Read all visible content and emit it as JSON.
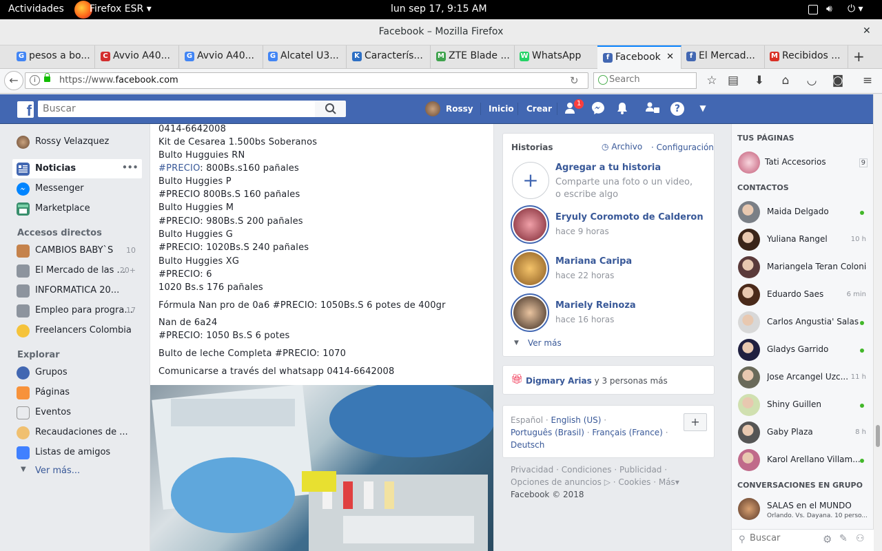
{
  "gnome": {
    "activities": "Actividades",
    "app": "Firefox ESR ▾",
    "clock": "lun sep 17,  9:15 AM"
  },
  "window": {
    "title": "Facebook – Mozilla Firefox"
  },
  "tabs": [
    {
      "label": "pesos a bo...",
      "color": "#4285f4",
      "letter": "G"
    },
    {
      "label": "Avvio A40...",
      "color": "#d32f2f",
      "letter": "C"
    },
    {
      "label": "Avvio A40...",
      "color": "#4285f4",
      "letter": "G"
    },
    {
      "label": "Alcatel U3...",
      "color": "#4285f4",
      "letter": "G"
    },
    {
      "label": "Caracterís...",
      "color": "#2d6fc4",
      "letter": "K"
    },
    {
      "label": "ZTE Blade ...",
      "color": "#3fa34d",
      "letter": "M"
    },
    {
      "label": "WhatsApp",
      "color": "#25d366",
      "letter": "W"
    },
    {
      "label": "Facebook",
      "color": "#4267b2",
      "letter": "f"
    },
    {
      "label": "El Mercad...",
      "color": "#4267b2",
      "letter": "f"
    },
    {
      "label": "Recibidos ...",
      "color": "#d93025",
      "letter": "M"
    }
  ],
  "nav": {
    "url_prefix": "https://www.",
    "url_domain": "facebook.com",
    "search_placeholder": "Search"
  },
  "fb": {
    "search_placeholder": "Buscar",
    "user": "Rossy",
    "home": "Inicio",
    "create": "Crear",
    "friend_badge": "1"
  },
  "left": {
    "profile": "Rossy Velazquez",
    "main": [
      {
        "label": "Noticias"
      },
      {
        "label": "Messenger"
      },
      {
        "label": "Marketplace"
      }
    ],
    "shortcuts_title": "Accesos directos",
    "shortcuts": [
      {
        "label": "CAMBIOS BABY`S",
        "count": "10"
      },
      {
        "label": "El Mercado de las ...",
        "count": "20+"
      },
      {
        "label": "INFORMATICA 20...",
        "count": ""
      },
      {
        "label": "Empleo para progra...",
        "count": "17"
      },
      {
        "label": "Freelancers Colombia",
        "count": ""
      }
    ],
    "explore_title": "Explorar",
    "explore": [
      {
        "label": "Grupos"
      },
      {
        "label": "Páginas"
      },
      {
        "label": "Eventos"
      },
      {
        "label": "Recaudaciones de ..."
      },
      {
        "label": "Listas de amigos"
      }
    ],
    "more": "Ver más..."
  },
  "post": {
    "lines": [
      {
        "text": "0414-6642008"
      },
      {
        "text": "Kit de Cesarea 1.500bs Soberanos"
      },
      {
        "text": "Bulto Hugguies RN"
      },
      {
        "hash": "#PRECIO",
        "text": ": 800Bs.s160 pañales"
      },
      {
        "text": "Bulto Huggies P"
      },
      {
        "text": "#PRECIO 800Bs.S 160 pañales"
      },
      {
        "text": "Bulto Huggies M"
      },
      {
        "text": "#PRECIO: 980Bs.S 200 pañales"
      },
      {
        "text": "Bulto Huggies G"
      },
      {
        "text": "#PRECIO: 1020Bs.S 240 pañales"
      },
      {
        "text": "Bulto Huggies XG"
      },
      {
        "text": "#PRECIO: 6"
      },
      {
        "text": "1020 Bs.s 176 pañales"
      },
      {
        "text": "Fórmula Nan pro de 0a6 #PRECIO: 1050Bs.S 6 potes de 400gr"
      },
      {
        "text": "Nan de 6a24"
      },
      {
        "text": "#PRECIO: 1050 Bs.S 6 potes"
      },
      {
        "text": "Bulto de leche Completa #PRECIO: 1070"
      },
      {
        "text": "Comunicarse a través del whatsapp 0414-6642008"
      }
    ]
  },
  "stories": {
    "title": "Historias",
    "archive": "Archivo",
    "settings": "Configuración",
    "add_title": "Agregar a tu historia",
    "add_desc": "Comparte una foto o un video, o escribe algo",
    "items": [
      {
        "name": "Eryuly Coromoto de Calderon",
        "time": "hace 9 horas"
      },
      {
        "name": "Mariana Caripa",
        "time": "hace 22 horas"
      },
      {
        "name": "Mariely Reinoza",
        "time": "hace 16 horas"
      }
    ],
    "more": "Ver más"
  },
  "birthday": {
    "name": "Digmary Arias",
    "rest": " y 3 personas más"
  },
  "languages": {
    "current": "Español",
    "list": [
      "English (US)",
      "Português (Brasil)",
      "Français (France)",
      "Deutsch"
    ]
  },
  "footer": {
    "links": [
      "Privacidad",
      "Condiciones",
      "Publicidad",
      "Opciones de anuncios",
      "Cookies",
      "Más"
    ],
    "copyright": "Facebook © 2018"
  },
  "chat": {
    "pages_title": "TUS PÁGINAS",
    "page": {
      "name": "Tati Accesorios",
      "count": "9"
    },
    "contacts_title": "CONTACTOS",
    "contacts": [
      {
        "name": "Maida Delgado",
        "status": "",
        "online": true
      },
      {
        "name": "Yuliana Rangel",
        "status": "10 h",
        "online": false
      },
      {
        "name": "Mariangela Teran Colonia",
        "status": "",
        "online": false
      },
      {
        "name": "Eduardo Saes",
        "status": "6 min",
        "online": false
      },
      {
        "name": "Carlos Angustia' Salas",
        "status": "",
        "online": true
      },
      {
        "name": "Gladys Garrido",
        "status": "",
        "online": true
      },
      {
        "name": "Jose Arcangel Uzc...",
        "status": "11 h",
        "online": false
      },
      {
        "name": "Shiny Guillen",
        "status": "",
        "online": true
      },
      {
        "name": "Gaby Plaza",
        "status": "8 h",
        "online": false
      },
      {
        "name": "Karol Arellano Villam...",
        "status": "",
        "online": true
      }
    ],
    "groups_title": "CONVERSACIONES EN GRUPO",
    "group": {
      "name": "SALAS en el MUNDO",
      "desc": "Orlando. Vs. Dayana. 10 perso..."
    },
    "search_placeholder": "Buscar"
  }
}
